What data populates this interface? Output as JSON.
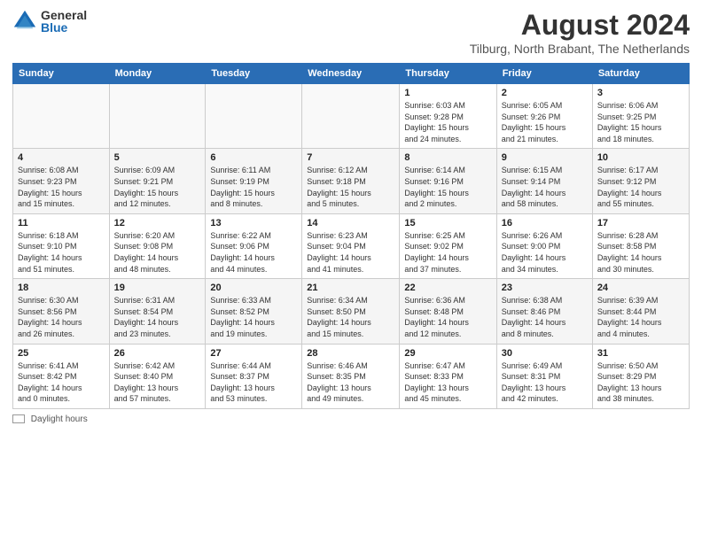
{
  "header": {
    "logo_general": "General",
    "logo_blue": "Blue",
    "month_title": "August 2024",
    "location": "Tilburg, North Brabant, The Netherlands"
  },
  "weekdays": [
    "Sunday",
    "Monday",
    "Tuesday",
    "Wednesday",
    "Thursday",
    "Friday",
    "Saturday"
  ],
  "footer": {
    "daylight_label": "Daylight hours"
  },
  "weeks": [
    [
      {
        "day": "",
        "info": ""
      },
      {
        "day": "",
        "info": ""
      },
      {
        "day": "",
        "info": ""
      },
      {
        "day": "",
        "info": ""
      },
      {
        "day": "1",
        "info": "Sunrise: 6:03 AM\nSunset: 9:28 PM\nDaylight: 15 hours\nand 24 minutes."
      },
      {
        "day": "2",
        "info": "Sunrise: 6:05 AM\nSunset: 9:26 PM\nDaylight: 15 hours\nand 21 minutes."
      },
      {
        "day": "3",
        "info": "Sunrise: 6:06 AM\nSunset: 9:25 PM\nDaylight: 15 hours\nand 18 minutes."
      }
    ],
    [
      {
        "day": "4",
        "info": "Sunrise: 6:08 AM\nSunset: 9:23 PM\nDaylight: 15 hours\nand 15 minutes."
      },
      {
        "day": "5",
        "info": "Sunrise: 6:09 AM\nSunset: 9:21 PM\nDaylight: 15 hours\nand 12 minutes."
      },
      {
        "day": "6",
        "info": "Sunrise: 6:11 AM\nSunset: 9:19 PM\nDaylight: 15 hours\nand 8 minutes."
      },
      {
        "day": "7",
        "info": "Sunrise: 6:12 AM\nSunset: 9:18 PM\nDaylight: 15 hours\nand 5 minutes."
      },
      {
        "day": "8",
        "info": "Sunrise: 6:14 AM\nSunset: 9:16 PM\nDaylight: 15 hours\nand 2 minutes."
      },
      {
        "day": "9",
        "info": "Sunrise: 6:15 AM\nSunset: 9:14 PM\nDaylight: 14 hours\nand 58 minutes."
      },
      {
        "day": "10",
        "info": "Sunrise: 6:17 AM\nSunset: 9:12 PM\nDaylight: 14 hours\nand 55 minutes."
      }
    ],
    [
      {
        "day": "11",
        "info": "Sunrise: 6:18 AM\nSunset: 9:10 PM\nDaylight: 14 hours\nand 51 minutes."
      },
      {
        "day": "12",
        "info": "Sunrise: 6:20 AM\nSunset: 9:08 PM\nDaylight: 14 hours\nand 48 minutes."
      },
      {
        "day": "13",
        "info": "Sunrise: 6:22 AM\nSunset: 9:06 PM\nDaylight: 14 hours\nand 44 minutes."
      },
      {
        "day": "14",
        "info": "Sunrise: 6:23 AM\nSunset: 9:04 PM\nDaylight: 14 hours\nand 41 minutes."
      },
      {
        "day": "15",
        "info": "Sunrise: 6:25 AM\nSunset: 9:02 PM\nDaylight: 14 hours\nand 37 minutes."
      },
      {
        "day": "16",
        "info": "Sunrise: 6:26 AM\nSunset: 9:00 PM\nDaylight: 14 hours\nand 34 minutes."
      },
      {
        "day": "17",
        "info": "Sunrise: 6:28 AM\nSunset: 8:58 PM\nDaylight: 14 hours\nand 30 minutes."
      }
    ],
    [
      {
        "day": "18",
        "info": "Sunrise: 6:30 AM\nSunset: 8:56 PM\nDaylight: 14 hours\nand 26 minutes."
      },
      {
        "day": "19",
        "info": "Sunrise: 6:31 AM\nSunset: 8:54 PM\nDaylight: 14 hours\nand 23 minutes."
      },
      {
        "day": "20",
        "info": "Sunrise: 6:33 AM\nSunset: 8:52 PM\nDaylight: 14 hours\nand 19 minutes."
      },
      {
        "day": "21",
        "info": "Sunrise: 6:34 AM\nSunset: 8:50 PM\nDaylight: 14 hours\nand 15 minutes."
      },
      {
        "day": "22",
        "info": "Sunrise: 6:36 AM\nSunset: 8:48 PM\nDaylight: 14 hours\nand 12 minutes."
      },
      {
        "day": "23",
        "info": "Sunrise: 6:38 AM\nSunset: 8:46 PM\nDaylight: 14 hours\nand 8 minutes."
      },
      {
        "day": "24",
        "info": "Sunrise: 6:39 AM\nSunset: 8:44 PM\nDaylight: 14 hours\nand 4 minutes."
      }
    ],
    [
      {
        "day": "25",
        "info": "Sunrise: 6:41 AM\nSunset: 8:42 PM\nDaylight: 14 hours\nand 0 minutes."
      },
      {
        "day": "26",
        "info": "Sunrise: 6:42 AM\nSunset: 8:40 PM\nDaylight: 13 hours\nand 57 minutes."
      },
      {
        "day": "27",
        "info": "Sunrise: 6:44 AM\nSunset: 8:37 PM\nDaylight: 13 hours\nand 53 minutes."
      },
      {
        "day": "28",
        "info": "Sunrise: 6:46 AM\nSunset: 8:35 PM\nDaylight: 13 hours\nand 49 minutes."
      },
      {
        "day": "29",
        "info": "Sunrise: 6:47 AM\nSunset: 8:33 PM\nDaylight: 13 hours\nand 45 minutes."
      },
      {
        "day": "30",
        "info": "Sunrise: 6:49 AM\nSunset: 8:31 PM\nDaylight: 13 hours\nand 42 minutes."
      },
      {
        "day": "31",
        "info": "Sunrise: 6:50 AM\nSunset: 8:29 PM\nDaylight: 13 hours\nand 38 minutes."
      }
    ]
  ]
}
